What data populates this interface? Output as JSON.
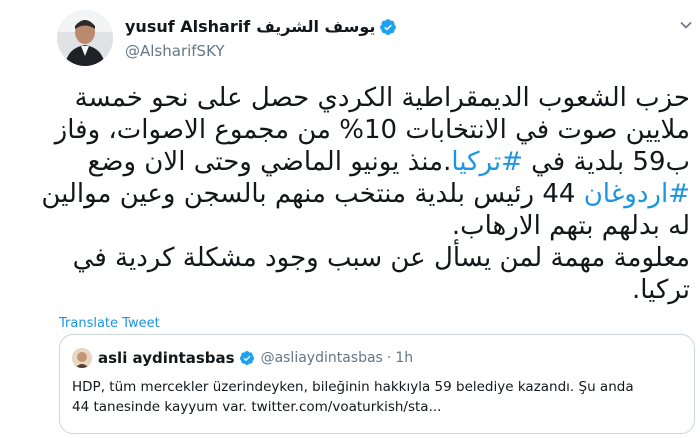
{
  "tweet": {
    "author": {
      "name": "yusuf Alsharif",
      "name_ar": "يوسف الشريف",
      "handle": "@AlsharifSKY"
    },
    "lines": [
      {
        "text": "حزب الشعوب الديمقراطية الكردي حصل على نحو خمسة"
      },
      {
        "text": "ملايين صوت في الانتخابات 10% من مجموع الاصوات، وفاز"
      },
      {
        "pre": "ب59 بلدية في ",
        "hashtag": "#تركيا",
        "post": ".منذ يونيو الماضي وحتى الان وضع"
      },
      {
        "hashtag": "#اردوغان",
        "post": " 44 رئيس بلدية منتخب منهم بالسجن وعين موالين"
      },
      {
        "text": "له بدلهم بتهم الارهاب."
      },
      {
        "text": "معلومة مهمة لمن يسأل عن سبب وجود مشكلة كردية في"
      },
      {
        "text": "تركيا."
      }
    ],
    "translate_label": "Translate Tweet"
  },
  "quote": {
    "name": "asli aydintasbas",
    "handle": "@asliaydintasbas",
    "separator": "·",
    "time": "1h",
    "lines": [
      "HDP, tüm mercekler üzerindeyken, bileğinin hakkıyla 59 belediye kazandı. Şu anda",
      "44 tanesinde kayyum var. twitter.com/voaturkish/sta..."
    ]
  },
  "colors": {
    "accent": "#1b95e0",
    "verified": "#1da1f2",
    "muted": "#657786",
    "border": "#ccd6dd"
  },
  "icons": {
    "verified": "verified-badge-icon",
    "menu": "chevron-down-icon"
  }
}
